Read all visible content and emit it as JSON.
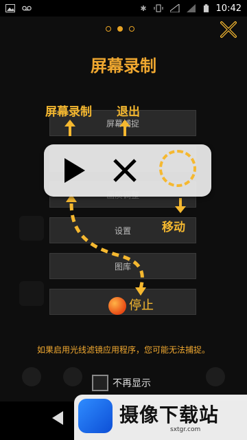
{
  "status_bar": {
    "time": "10:42"
  },
  "pager": {
    "pages": 3,
    "active_index": 1
  },
  "title": "屏幕录制",
  "menu": {
    "items": [
      "屏幕捕捉",
      "",
      "画质调整",
      "设置",
      "图库",
      ""
    ]
  },
  "annotations": {
    "record_label": "屏幕录制",
    "exit_label": "退出",
    "move_label": "移动",
    "stop_label": "停止"
  },
  "warning_text": "如果启用光线滤镜应用程序，您可能无法捕捉。",
  "checkbox": {
    "label": "不再显示",
    "checked": false
  },
  "watermark": {
    "name": "摄像下载站",
    "url": "sxtgr.com"
  },
  "colors": {
    "accent": "#f5b830",
    "title": "#f0a830"
  }
}
